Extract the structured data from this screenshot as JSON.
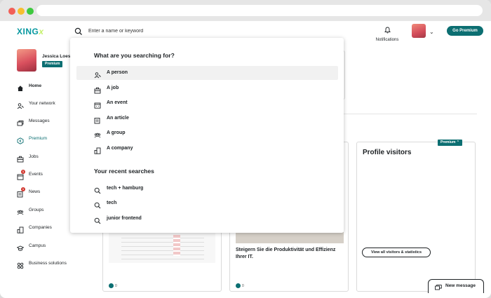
{
  "colors": {
    "accent": "#0c6f72",
    "brand": "#0698a0",
    "alert": "#d0342c"
  },
  "header": {
    "logo": "XING",
    "logo_mark": "x",
    "search_placeholder": "Enter a name or keyword",
    "notifications_label": "Notifications",
    "go_premium_label": "Go Premium"
  },
  "profile": {
    "name": "Jessica Loest",
    "badge": "Premium"
  },
  "sidebar": {
    "items": [
      {
        "label": "Home",
        "icon": "home-icon"
      },
      {
        "label": "Your network",
        "icon": "network-icon"
      },
      {
        "label": "Messages",
        "icon": "messages-icon"
      },
      {
        "label": "Premium",
        "icon": "premium-icon"
      },
      {
        "label": "Jobs",
        "icon": "briefcase-icon"
      },
      {
        "label": "Events",
        "icon": "calendar-icon",
        "badge": "1"
      },
      {
        "label": "News",
        "icon": "news-icon",
        "badge": "1"
      },
      {
        "label": "Groups",
        "icon": "groups-icon"
      },
      {
        "label": "Companies",
        "icon": "company-icon"
      },
      {
        "label": "Campus",
        "icon": "campus-icon"
      },
      {
        "label": "Business solutions",
        "icon": "grid-icon"
      }
    ]
  },
  "search_dropdown": {
    "heading": "What are you searching for?",
    "options": [
      {
        "label": "A person",
        "icon": "person-icon"
      },
      {
        "label": "A job",
        "icon": "briefcase-icon"
      },
      {
        "label": "An event",
        "icon": "calendar-icon"
      },
      {
        "label": "An article",
        "icon": "article-icon"
      },
      {
        "label": "A group",
        "icon": "groups-icon"
      },
      {
        "label": "A company",
        "icon": "company-icon"
      }
    ],
    "recent_heading": "Your recent searches",
    "recent": [
      "tech + hamburg",
      "tech",
      "junior frontend"
    ]
  },
  "feed": {
    "card2_title": "Steigern Sie die Produktivität und Effizienz Ihrer IT.",
    "like_count": "0",
    "visitors": {
      "title": "Profile visitors",
      "premium_tag": "Premium",
      "button": "View all visitors & statistics"
    },
    "new_message": "New message"
  }
}
